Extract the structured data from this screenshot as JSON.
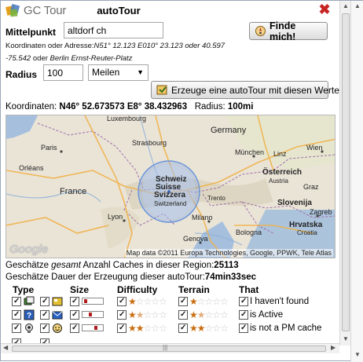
{
  "header": {
    "logo_text": "GC Tour",
    "title": "autoTour",
    "close_glyph": "✖"
  },
  "form": {
    "center_label": "Mittelpunkt",
    "center_value": "altdorf ch",
    "hint_line1_prefix": "Koordinaten oder Adresse:",
    "hint_line1_example": "N51° 12.123 E010° 23.123 oder 40.597",
    "hint_line2_example": "-75.542",
    "hint_line2_or": " oder ",
    "hint_line2_address": "Berlin Ernst-Reuter-Platz",
    "find_button": "Finde mich!",
    "radius_label": "Radius",
    "radius_value": "100",
    "unit_selected": "Meilen",
    "create_button": "Erzeuge eine autoTour mit diesen Werten!"
  },
  "status": {
    "coords_prefix": "Koordinaten: ",
    "coords_value": "N46° 52.673573 E8° 38.432963",
    "radius_prefix": "Radius: ",
    "radius_value": "100mi"
  },
  "map": {
    "labels": {
      "luxembourg": "Luxembourg",
      "germany": "Germany",
      "france": "France",
      "schweiz": "Schweiz",
      "suisse": "Suisse",
      "svizzera": "Svizzera",
      "switzerland": "Switzerland",
      "osterreich": "Österreich",
      "austria": "Austria",
      "slovenija": "Slovenija",
      "hrvatska": "Hrvatska",
      "croatia": "Croatia",
      "paris": "Paris",
      "munchen": "München",
      "wien": "Wien",
      "lyon": "Lyon",
      "milano": "Milano",
      "genova": "Genova",
      "bologna": "Bologna",
      "zagreb": "Zagreb",
      "trento": "Trento",
      "orleans": "Orléans",
      "strasbourg": "Strasbourg",
      "linz": "Linz",
      "graz": "Graz"
    },
    "google_logo": "Google",
    "copyright": "Map data ©2011 Europa Technologies, Google, PPWK, Tele Atlas"
  },
  "summary": {
    "line1_prefix": "Geschätze ",
    "line1_em": "gesamt",
    "line1_mid": " Anzahl Caches in dieser Region:",
    "line1_count": "25113",
    "line2_prefix": "Geschätze Dauer der Erzeugung dieser autoTour:",
    "line2_value": "74min33sec"
  },
  "filters": {
    "headers": {
      "type": "Type",
      "size": "Size",
      "difficulty": "Difficulty",
      "terrain": "Terrain",
      "that": "That"
    },
    "rows": [
      {
        "size_fill": 0.25,
        "difficulty_stars": 1,
        "terrain_stars": 1,
        "that": "I haven't found"
      },
      {
        "size_fill": 0.5,
        "difficulty_stars": 1.5,
        "terrain_stars": 1.5,
        "that": "is Active"
      },
      {
        "size_fill": 0.75,
        "difficulty_stars": 2,
        "terrain_stars": 2,
        "that": "is not a PM cache"
      }
    ],
    "star_glyph_on": "★",
    "star_glyph_off": "☆"
  },
  "colors": {
    "close": "#c82323",
    "star_on": "#c86b0f",
    "size_fill": "#b11d1d",
    "map_circle": "#7aa4e6"
  }
}
